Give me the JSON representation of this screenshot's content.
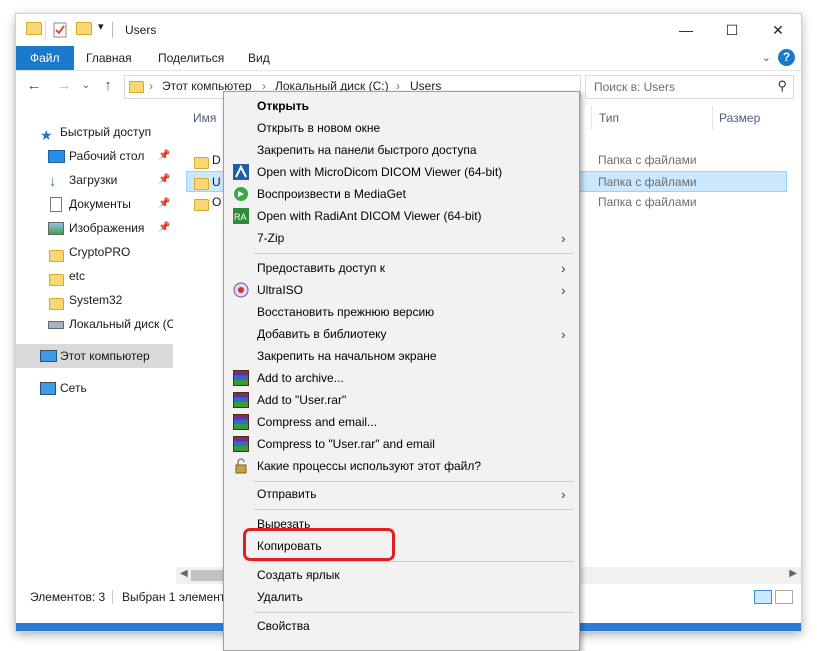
{
  "window": {
    "title": "Users",
    "buttons": {
      "minimize": "—",
      "maximize": "☐",
      "close": "✕"
    }
  },
  "ribbon": {
    "tabs": [
      "Файл",
      "Главная",
      "Поделиться",
      "Вид"
    ],
    "help": "?"
  },
  "address": {
    "crumbs": [
      "Этот компьютер",
      "Локальный диск (C:)",
      "Users"
    ],
    "search_placeholder": "Поиск в: Users"
  },
  "nav_pane": {
    "items": [
      {
        "label": "Быстрый доступ",
        "icon": "star-icon",
        "pinned": false
      },
      {
        "label": "Рабочий стол",
        "icon": "desktop-icon",
        "pinned": true
      },
      {
        "label": "Загрузки",
        "icon": "download-icon",
        "pinned": true
      },
      {
        "label": "Документы",
        "icon": "document-icon",
        "pinned": true
      },
      {
        "label": "Изображения",
        "icon": "image-icon",
        "pinned": true
      },
      {
        "label": "CryptoPRO",
        "icon": "folder-icon",
        "pinned": false
      },
      {
        "label": "etc",
        "icon": "folder-icon",
        "pinned": false
      },
      {
        "label": "System32",
        "icon": "folder-icon",
        "pinned": false
      },
      {
        "label": "Локальный диск (C",
        "icon": "drive-icon",
        "pinned": false
      },
      {
        "label": "Этот компьютер",
        "icon": "computer-icon",
        "pinned": false
      },
      {
        "label": "Сеть",
        "icon": "network-icon",
        "pinned": false
      }
    ]
  },
  "columns": {
    "name": "Имя",
    "type": "Тип",
    "size": "Размер"
  },
  "rows": [
    {
      "name": "D",
      "type": "Папка с файлами"
    },
    {
      "name": "U",
      "type": "Папка с файлами"
    },
    {
      "name": "O",
      "type": "Папка с файлами"
    }
  ],
  "status": {
    "count": "Элементов: 3",
    "selected": "Выбран 1 элемент"
  },
  "context_menu": {
    "items": [
      {
        "label": "Открыть",
        "icon": "",
        "bold": true,
        "submenu": false
      },
      {
        "label": "Открыть в новом окне",
        "icon": "",
        "bold": false,
        "submenu": false
      },
      {
        "label": "Закрепить на панели быстрого доступа",
        "icon": "",
        "bold": false,
        "submenu": false
      },
      {
        "label": "Open with MicroDicom DICOM Viewer (64-bit)",
        "icon": "microdicom-icon",
        "bold": false,
        "submenu": false
      },
      {
        "label": "Воспроизвести в MediaGet",
        "icon": "mediaget-icon",
        "bold": false,
        "submenu": false
      },
      {
        "label": "Open with RadiAnt DICOM Viewer (64-bit)",
        "icon": "radiant-icon",
        "bold": false,
        "submenu": false
      },
      {
        "label": "7-Zip",
        "icon": "",
        "bold": false,
        "submenu": true
      },
      {
        "sep": true
      },
      {
        "label": "Предоставить доступ к",
        "icon": "",
        "bold": false,
        "submenu": true
      },
      {
        "label": "UltraISO",
        "icon": "ultraiso-icon",
        "bold": false,
        "submenu": true
      },
      {
        "label": "Восстановить прежнюю версию",
        "icon": "",
        "bold": false,
        "submenu": false
      },
      {
        "label": "Добавить в библиотеку",
        "icon": "",
        "bold": false,
        "submenu": true
      },
      {
        "label": "Закрепить на начальном экране",
        "icon": "",
        "bold": false,
        "submenu": false
      },
      {
        "label": "Add to archive...",
        "icon": "winrar-icon",
        "bold": false,
        "submenu": false
      },
      {
        "label": "Add to \"User.rar\"",
        "icon": "winrar-icon",
        "bold": false,
        "submenu": false
      },
      {
        "label": "Compress and email...",
        "icon": "winrar-icon",
        "bold": false,
        "submenu": false
      },
      {
        "label": "Compress to \"User.rar\" and email",
        "icon": "winrar-icon",
        "bold": false,
        "submenu": false
      },
      {
        "label": "Какие процессы используют этот файл?",
        "icon": "lock-icon",
        "bold": false,
        "submenu": false
      },
      {
        "sep": true
      },
      {
        "label": "Отправить",
        "icon": "",
        "bold": false,
        "submenu": true
      },
      {
        "sep": true
      },
      {
        "label": "Вырезать",
        "icon": "",
        "bold": false,
        "submenu": false
      },
      {
        "label": "Копировать",
        "icon": "",
        "bold": false,
        "submenu": false
      },
      {
        "sep": true
      },
      {
        "label": "Создать ярлык",
        "icon": "",
        "bold": false,
        "submenu": false
      },
      {
        "label": "Удалить",
        "icon": "",
        "bold": false,
        "submenu": false
      },
      {
        "sep": true
      },
      {
        "label": "Свойства",
        "icon": "",
        "bold": false,
        "submenu": false
      }
    ]
  },
  "colors": {
    "accent": "#1979ca",
    "selection": "#cce8ff",
    "highlight": "#e02020"
  }
}
